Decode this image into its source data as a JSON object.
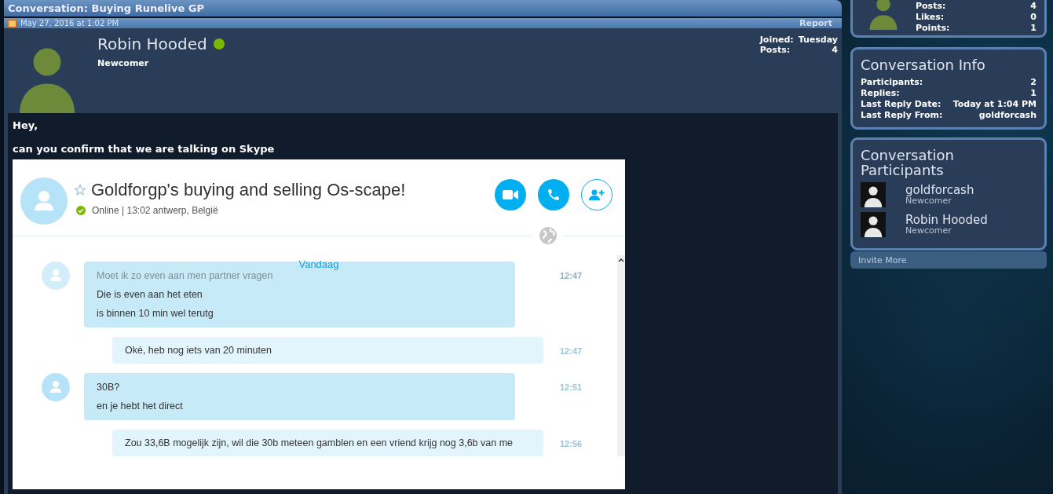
{
  "title": "Conversation: Buying Runelive GP",
  "post": {
    "date": "May 27, 2016 at 1:02 PM",
    "report": "Report",
    "author": {
      "name": "Robin Hooded",
      "online": true,
      "title": "Newcomer"
    },
    "stats": [
      {
        "label": "Joined:",
        "value": "Tuesday"
      },
      {
        "label": "Posts:",
        "value": "4"
      }
    ],
    "paragraphs": [
      "Hey,",
      "can you confirm that we are talking on Skype"
    ]
  },
  "skype": {
    "contact": "Goldforgp's buying and selling Os-scape!",
    "status": "Online | 13:02 antwerp, België",
    "day_label": "Vandaag",
    "messages": [
      {
        "kind": "incoming",
        "avatar": true,
        "lines": [
          {
            "text": "Moet ik zo even aan men partner vragen",
            "faded": true
          },
          {
            "text": "Die is even aan het eten",
            "faded": false
          },
          {
            "text": "is binnen 10 min wel terutg",
            "faded": false
          }
        ],
        "time": "12:47",
        "time_faded": true
      },
      {
        "kind": "outgoing",
        "avatar": false,
        "lines": [
          {
            "text": "Oké, heb nog iets van 20 minuten",
            "faded": false
          }
        ],
        "time": "12:47",
        "time_faded": false
      },
      {
        "kind": "incoming",
        "avatar": true,
        "lines": [
          {
            "text": "30B?",
            "faded": false
          },
          {
            "text": "en je hebt het direct",
            "faded": false
          }
        ],
        "time": "12:51",
        "time_faded": false
      },
      {
        "kind": "outgoing",
        "avatar": false,
        "lines": [
          {
            "text": "Zou 33,6B mogelijk zijn, wil die 30b meteen gamblen en een vriend krijg nog 3,6b van me",
            "faded": false
          }
        ],
        "time": "12:56",
        "time_faded": false
      }
    ]
  },
  "sidebar": {
    "member_stats": [
      {
        "label": "Posts:",
        "value": "4"
      },
      {
        "label": "Likes:",
        "value": "0"
      },
      {
        "label": "Points:",
        "value": "1"
      }
    ],
    "info": {
      "title": "Conversation Info",
      "rows": [
        {
          "label": "Participants:",
          "value": "2"
        },
        {
          "label": "Replies:",
          "value": "1"
        },
        {
          "label": "Last Reply Date:",
          "value": "Today at 1:04 PM"
        },
        {
          "label": "Last Reply From:",
          "value": "goldforcash"
        }
      ]
    },
    "participants": {
      "title": "Conversation Participants",
      "people": [
        {
          "name": "goldforcash",
          "title": "Newcomer"
        },
        {
          "name": "Robin Hooded",
          "title": "Newcomer"
        }
      ]
    },
    "invite": "Invite More"
  }
}
